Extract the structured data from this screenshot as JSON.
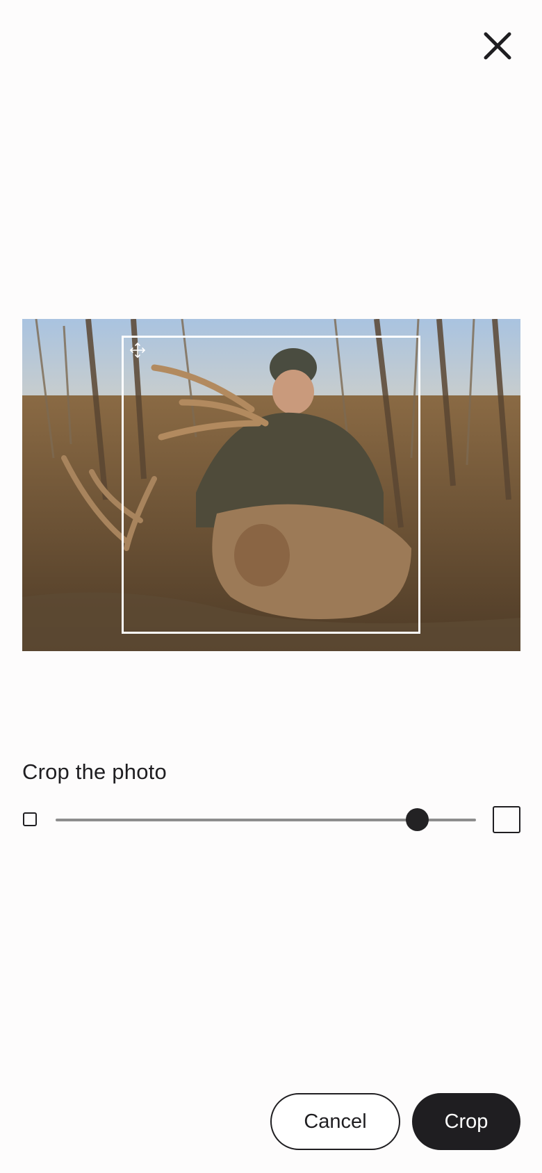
{
  "dialog": {
    "close_icon": "close-icon",
    "photo_description_icon": "photo",
    "title": "Crop the photo",
    "slider": {
      "min_icon": "small-square-icon",
      "max_icon": "large-square-icon",
      "value_fraction": 0.86
    },
    "buttons": {
      "cancel_label": "Cancel",
      "crop_label": "Crop"
    }
  },
  "colors": {
    "primary": "#1f1e21",
    "background": "#fdfcfc",
    "track": "#8d8d8d",
    "crop_frame": "#ffffff"
  }
}
